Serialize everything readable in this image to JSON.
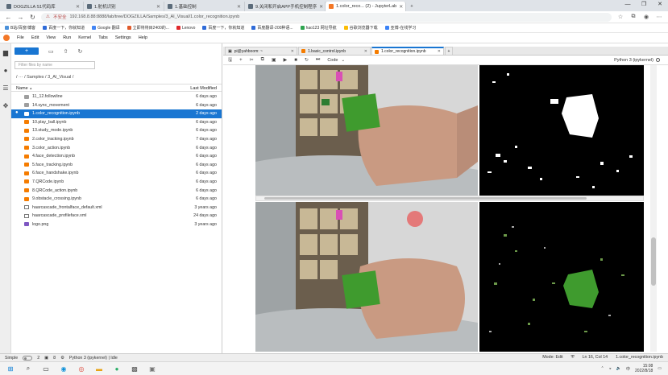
{
  "browser": {
    "tabs": [
      {
        "label": "DOGZILLA S1代码库",
        "color": "#5b6b7a",
        "active": false
      },
      {
        "label": "1.舵机识别",
        "color": "#5b6b7a",
        "active": false
      },
      {
        "label": "1.基础控制",
        "color": "#5b6b7a",
        "active": false
      },
      {
        "label": "9.关闭和开启APP手机控制程序",
        "color": "#5b6b7a",
        "active": false
      },
      {
        "label": "1.color_reco... (2) - JupyterLab",
        "color": "#f37726",
        "active": true
      }
    ],
    "new_tab": "+",
    "window_controls": [
      "—",
      "❐",
      "✕"
    ],
    "address": {
      "security_label": "不安全",
      "url": "192.168.8.88:8888/lab/tree/DOGZILLA/Samples/3_AI_Visual/1.color_recognition.ipynb"
    },
    "bookmarks": [
      {
        "label": "B站/百度/博客",
        "color": "#4a90d9"
      },
      {
        "label": "百度一下，你就知道",
        "color": "#2f6bd8"
      },
      {
        "label": "Google 翻译",
        "color": "#4285f4"
      },
      {
        "label": "立即将将目2400的...",
        "color": "#e05a2b"
      },
      {
        "label": "Lenovo",
        "color": "#e0282b"
      },
      {
        "label": "百度一下，你就知道",
        "color": "#2f6bd8"
      },
      {
        "label": "百度翻译-200种语...",
        "color": "#2f6bd8"
      },
      {
        "label": "hao123 网址导航",
        "color": "#2ea44f"
      },
      {
        "label": "谷歌浏览器下载",
        "color": "#fbbc05"
      },
      {
        "label": "亚博-在线学习",
        "color": "#3b82f6"
      }
    ]
  },
  "menu": [
    "File",
    "Edit",
    "View",
    "Run",
    "Kernel",
    "Tabs",
    "Settings",
    "Help"
  ],
  "filebrowser": {
    "new_label": "+",
    "filter_placeholder": "Filter files by name",
    "breadcrumb": "/ ··· / Samples / 3_AI_Visual /",
    "col_name": "Name",
    "col_modified": "Last Modified",
    "sort_arrow": "▲",
    "files": [
      {
        "name": "11_12.followline",
        "modified": "6 days ago",
        "kind": "folder",
        "selected": false,
        "running": false
      },
      {
        "name": "14.sync_movement",
        "modified": "6 days ago",
        "kind": "folder",
        "selected": false,
        "running": false
      },
      {
        "name": "1.color_recognition.ipynb",
        "modified": "2 days ago",
        "kind": "nb",
        "selected": true,
        "running": true
      },
      {
        "name": "10.play_ball.ipynb",
        "modified": "6 days ago",
        "kind": "nb",
        "selected": false,
        "running": false
      },
      {
        "name": "13.study_mode.ipynb",
        "modified": "6 days ago",
        "kind": "nb",
        "selected": false,
        "running": false
      },
      {
        "name": "2.color_tracking.ipynb",
        "modified": "7 days ago",
        "kind": "nb",
        "selected": false,
        "running": false
      },
      {
        "name": "3.color_action.ipynb",
        "modified": "6 days ago",
        "kind": "nb",
        "selected": false,
        "running": false
      },
      {
        "name": "4.face_detection.ipynb",
        "modified": "6 days ago",
        "kind": "nb",
        "selected": false,
        "running": false
      },
      {
        "name": "5.face_tracking.ipynb",
        "modified": "6 days ago",
        "kind": "nb",
        "selected": false,
        "running": false
      },
      {
        "name": "6.face_handshake.ipynb",
        "modified": "6 days ago",
        "kind": "nb",
        "selected": false,
        "running": false
      },
      {
        "name": "7.QRCode.ipynb",
        "modified": "6 days ago",
        "kind": "nb",
        "selected": false,
        "running": false
      },
      {
        "name": "8.QRCode_action.ipynb",
        "modified": "6 days ago",
        "kind": "nb",
        "selected": false,
        "running": false
      },
      {
        "name": "9.obstacle_crossing.ipynb",
        "modified": "6 days ago",
        "kind": "nb",
        "selected": false,
        "running": false
      },
      {
        "name": "haarcascade_frontalface_default.xml",
        "modified": "3 years ago",
        "kind": "doc",
        "selected": false,
        "running": false
      },
      {
        "name": "haarcascade_profileface.xml",
        "modified": "24 days ago",
        "kind": "doc",
        "selected": false,
        "running": false
      },
      {
        "name": "logo.png",
        "modified": "3 years ago",
        "kind": "img",
        "selected": false,
        "running": false
      }
    ]
  },
  "notebook": {
    "tabs": [
      {
        "label": "pi@yahboom: ~",
        "active": false
      },
      {
        "label": "1.basic_control.ipynb",
        "active": false
      },
      {
        "label": "1.color_recognition.ipynb",
        "active": true
      }
    ],
    "cell_type": "Code",
    "kernel": "Python 3 (ipykernel)"
  },
  "statusbar": {
    "mode": "Simple",
    "count1": "2",
    "count2": "8",
    "kernel_status": "Python 3 (ipykernel) | Idle",
    "edit_mode": "Mode: Edit",
    "cursor": "Ln 16, Col 14",
    "filename": "1.color_recognition.ipynb"
  },
  "taskbar": {
    "time": "15:08",
    "date": "2022/8/18"
  }
}
